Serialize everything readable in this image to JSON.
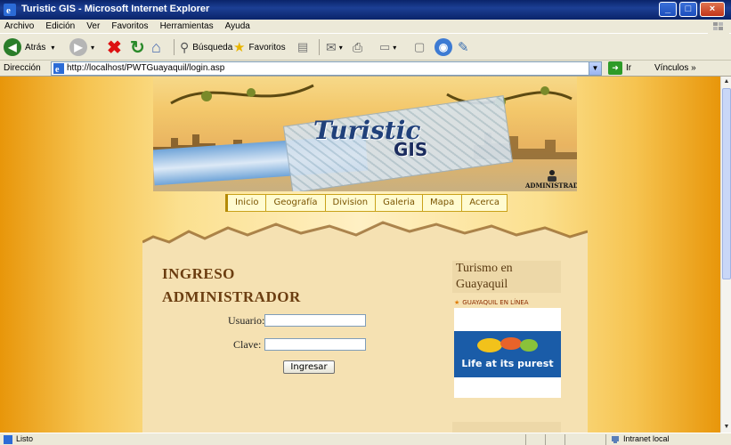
{
  "window": {
    "title": "Turistic GIS - Microsoft Internet Explorer"
  },
  "menubar": {
    "items": [
      "Archivo",
      "Edición",
      "Ver",
      "Favoritos",
      "Herramientas",
      "Ayuda"
    ]
  },
  "toolbar": {
    "back_label": "Atrás",
    "search_label": "Búsqueda",
    "favorites_label": "Favoritos"
  },
  "addressbar": {
    "label": "Dirección",
    "url": "http://localhost/PWTGuayaquil/login.asp",
    "go_label": "Ir",
    "links_label": "Vínculos"
  },
  "banner": {
    "brand_line1": "Turistic",
    "brand_line2": "GIS",
    "admin_label": "ADMINISTRADOR"
  },
  "nav": {
    "items": [
      "Inicio",
      "Geografía",
      "Division",
      "Galeria",
      "Mapa",
      "Acerca"
    ]
  },
  "login": {
    "title_line1": "INGRESO",
    "title_line2": "ADMINISTRADOR",
    "user_label": "Usuario:",
    "user_value": "",
    "pass_label": "Clave:",
    "pass_value": "",
    "submit_label": "Ingresar"
  },
  "sidebar": {
    "heading_line1": "Turismo en",
    "heading_line2": "Guayaquil",
    "link": "GUAYAQUIL EN LÍNEA",
    "promo_tagline": "Life at its purest"
  },
  "statusbar": {
    "status": "Listo",
    "zone": "Intranet local"
  },
  "colors": {
    "title_bar": "#0a246a",
    "nav_text": "#7a5400",
    "login_title": "#6b3d10",
    "promo_blue": "#1a5ca8"
  }
}
